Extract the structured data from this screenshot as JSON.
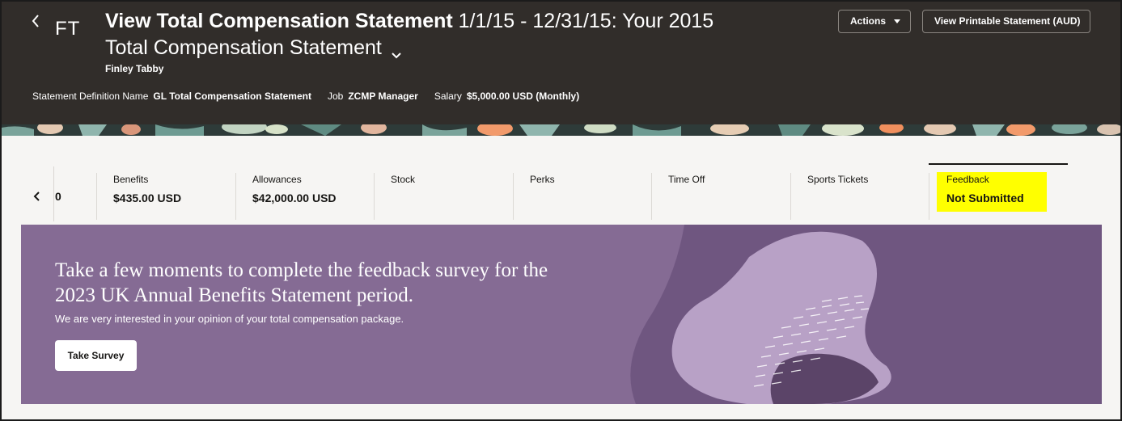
{
  "header": {
    "back_label": "‹",
    "avatar_initials": "FT",
    "title_bold": "View Total Compensation Statement",
    "title_rest": "1/1/15 - 12/31/15: Your 2015 Total Compensation Statement",
    "person_name": "Finley Tabby",
    "meta": {
      "statement_label": "Statement Definition Name",
      "statement_value": "GL Total Compensation Statement",
      "job_label": "Job",
      "job_value": "ZCMP Manager",
      "salary_label": "Salary",
      "salary_value": "$5,000.00 USD (Monthly)"
    },
    "actions_label": "Actions",
    "print_label": "View Printable Statement (AUD)"
  },
  "tabs": {
    "cut_value": "0",
    "items": [
      {
        "label": "Benefits",
        "value": "$435.00 USD"
      },
      {
        "label": "Allowances",
        "value": "$42,000.00 USD"
      },
      {
        "label": "Stock",
        "value": ""
      },
      {
        "label": "Perks",
        "value": ""
      },
      {
        "label": "Time Off",
        "value": ""
      },
      {
        "label": "Sports Tickets",
        "value": ""
      },
      {
        "label": "Feedback",
        "value": "Not Submitted"
      }
    ],
    "selected": "Feedback",
    "highlight_color": "#ffff00"
  },
  "banner": {
    "heading": "Take a few moments to complete the feedback survey for the 2023 UK Annual Benefits Statement period.",
    "subtext": "We are very interested in your opinion of your total compensation package.",
    "button_label": "Take Survey",
    "background_color": "#856b94"
  },
  "colors": {
    "header_bg": "#312d2a",
    "page_bg": "#f6f5f3"
  },
  "icons": {
    "back": "chevron-left-icon",
    "title_dropdown": "chevron-down-icon",
    "actions_caret": "caret-down-icon",
    "tabs_prev": "chevron-left-icon"
  }
}
